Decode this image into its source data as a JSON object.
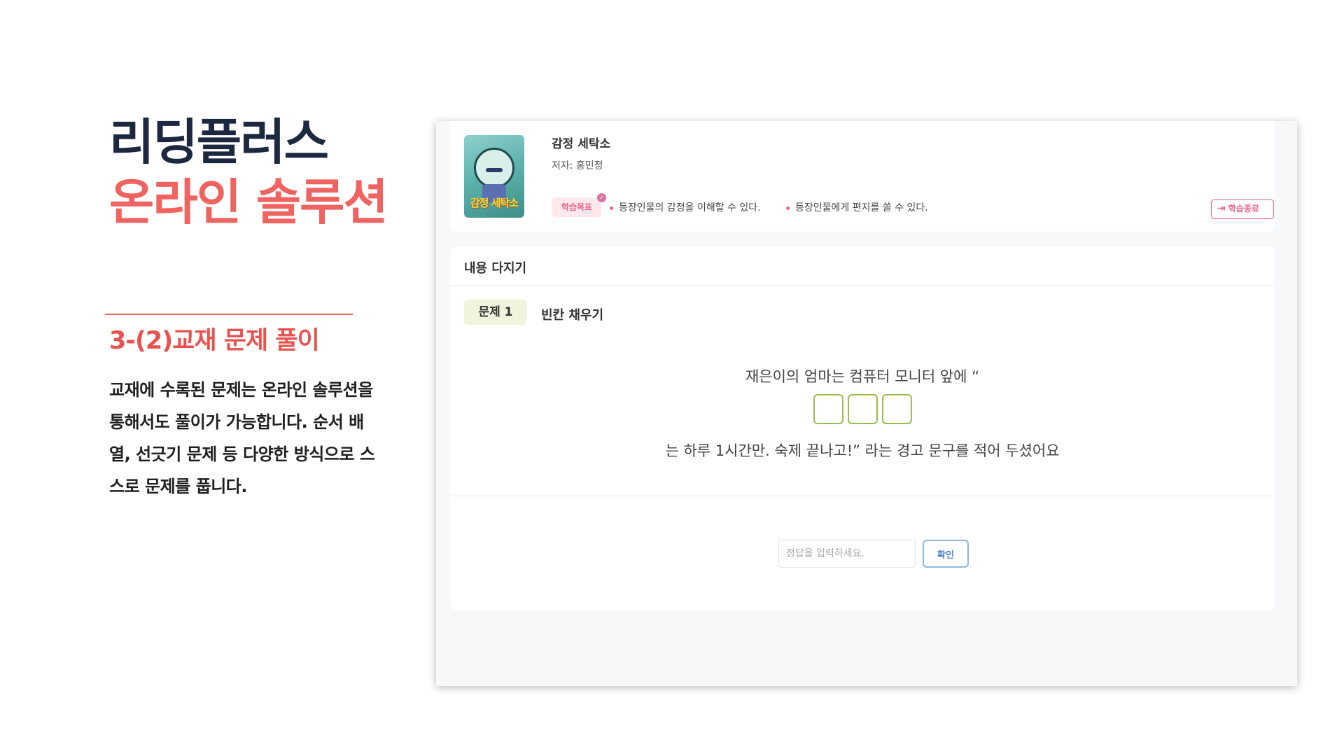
{
  "slide": {
    "title_main": "리딩플러스",
    "title_sub": "온라인 솔루션",
    "section_title": "3-(2)교재 문제 풀이",
    "description": "교재에 수록된 문제는 온라인 솔루션을 통해서도 풀이가 가능합니다. 순서 배열, 선긋기 문제 등 다양한 방식으로 스스로 문제를 풉니다.",
    "accent_color": "#ef6461",
    "title_color": "#1c2840"
  },
  "book": {
    "cover_title": "감정 세탁소",
    "title": "감정 세탁소",
    "author": "저자: 홍민정",
    "goal_label": "학습목표",
    "goals": [
      "등장인물의 감정을 이해할 수 있다.",
      "등장인물에게 편지를 쓸 수 있다."
    ],
    "end_label": "학습종료",
    "end_icon": "exit-icon"
  },
  "quiz": {
    "section_label": "내용 다지기",
    "question_badge": "문제 1",
    "question_type": "빈칸 채우기",
    "text_before": "재은이의 엄마는 컴퓨터 모니터 앞에 “",
    "blank_count": 3,
    "text_after": "는 하루 1시간만. 숙제 끝나고!” 라는 경고 문구를 적어 두셨어요",
    "input_value": "",
    "input_placeholder": "정답을 입력하세요.",
    "confirm_label": "확인",
    "blank_color": "#9bbd4c"
  }
}
